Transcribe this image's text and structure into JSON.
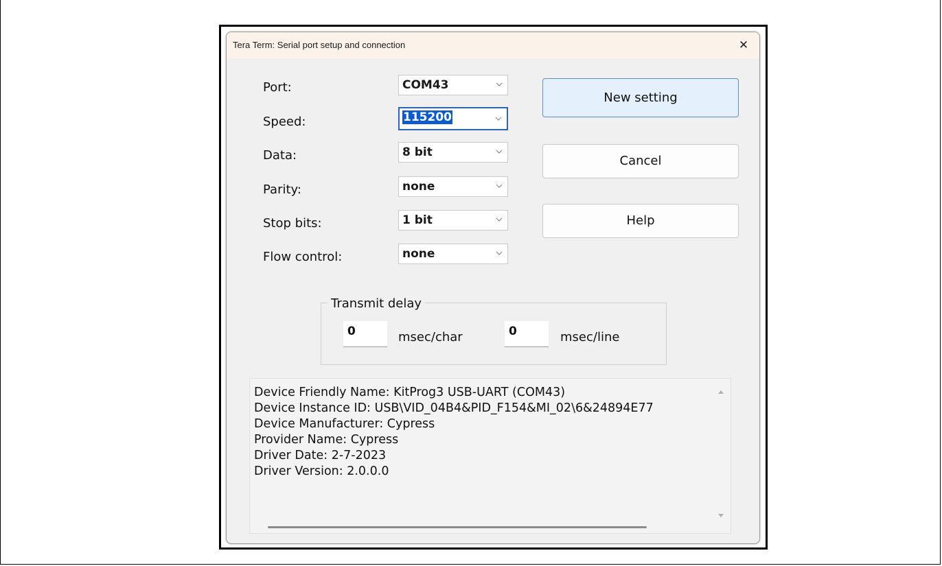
{
  "dialog": {
    "title": "Tera Term: Serial port setup and connection",
    "close_glyph": "✕"
  },
  "fields": [
    {
      "label": "Port:",
      "value": "COM43"
    },
    {
      "label": "Speed:",
      "value": "115200"
    },
    {
      "label": "Data:",
      "value": "8 bit"
    },
    {
      "label": "Parity:",
      "value": "none"
    },
    {
      "label": "Stop bits:",
      "value": "1 bit"
    },
    {
      "label": "Flow control:",
      "value": "none"
    }
  ],
  "buttons": {
    "new_setting": "New setting",
    "cancel": "Cancel",
    "help": "Help"
  },
  "transmit_delay": {
    "title": "Transmit delay",
    "char_value": "0",
    "char_unit": "msec/char",
    "line_value": "0",
    "line_unit": "msec/line"
  },
  "device_info": [
    "Device Friendly Name: KitProg3 USB-UART (COM43)",
    "Device Instance ID: USB\\VID_04B4&PID_F154&MI_02\\6&24894E77",
    "Device Manufacturer: Cypress",
    "Provider Name: Cypress",
    "Driver Date: 2-7-2023",
    "Driver Version: 2.0.0.0"
  ],
  "icons": {
    "close": "close-icon",
    "dropdown": "chevron-down-icon",
    "scroll_up": "scroll-up-arrow-icon",
    "scroll_down": "scroll-down-arrow-icon"
  },
  "colors": {
    "titlebar": "#fbf3ea",
    "selection": "#0a5ad4",
    "default_button": "#e4f0fb",
    "default_button_border": "#5a8fd0"
  }
}
